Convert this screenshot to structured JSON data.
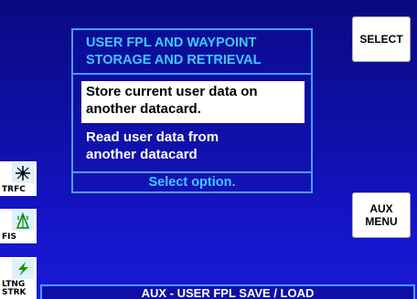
{
  "dialog": {
    "title_line1": "USER FPL AND WAYPOINT",
    "title_line2": "STORAGE AND RETRIEVAL",
    "options": [
      {
        "line1": "Store current user data on",
        "line2": "another datacard."
      },
      {
        "line1": "Read user data from",
        "line2": "another datacard"
      }
    ],
    "status": "Select option."
  },
  "softkeys": {
    "select_label": "SELECT",
    "aux_menu_line1": "AUX",
    "aux_menu_line2": "MENU"
  },
  "sidekeys": {
    "trfc": {
      "label": "TRFC",
      "icon": "traffic-icon"
    },
    "fis": {
      "label": "FIS",
      "icon": "weather-tower-icon"
    },
    "ltng": {
      "label_line1": "LTNG",
      "label_line2": "STRK",
      "icon": "lightning-icon"
    }
  },
  "page_title": "AUX - USER FPL SAVE / LOAD",
  "colors": {
    "background": "#1212b5",
    "accent_cyan": "#3fc8ff",
    "border": "#4a9aff",
    "highlight": "#ffffff"
  }
}
